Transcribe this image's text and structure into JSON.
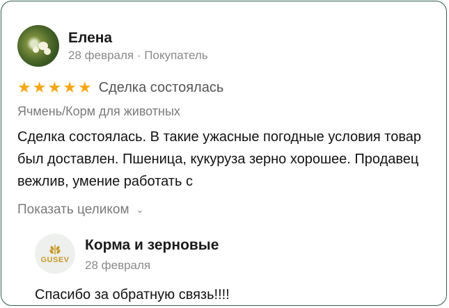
{
  "review": {
    "author": "Елена",
    "date": "28 февраля",
    "separator": "·",
    "role": "Покупатель",
    "rating": 5,
    "rating_text": "Сделка состоялась",
    "product": "Ячмень/Корм для животных",
    "text": "Сделка состоялась. В такие ужасные погодные условия товар был доставлен. Пшеница, кукуруза зерно хорошее. Продавец вежлив, умение работать с",
    "show_more": "Показать целиком",
    "avatar_icon": "avatar-photo-flowers"
  },
  "reply": {
    "logo_text": "GUSEV",
    "logo_icon": "wheat-logo-icon",
    "name": "Корма и зерновые",
    "date": "28 февраля",
    "text": "Спасибо за обратную связь!!!!"
  },
  "colors": {
    "star": "#f6a614",
    "border": "#2f5d4a",
    "logo": "#c79a2a"
  }
}
